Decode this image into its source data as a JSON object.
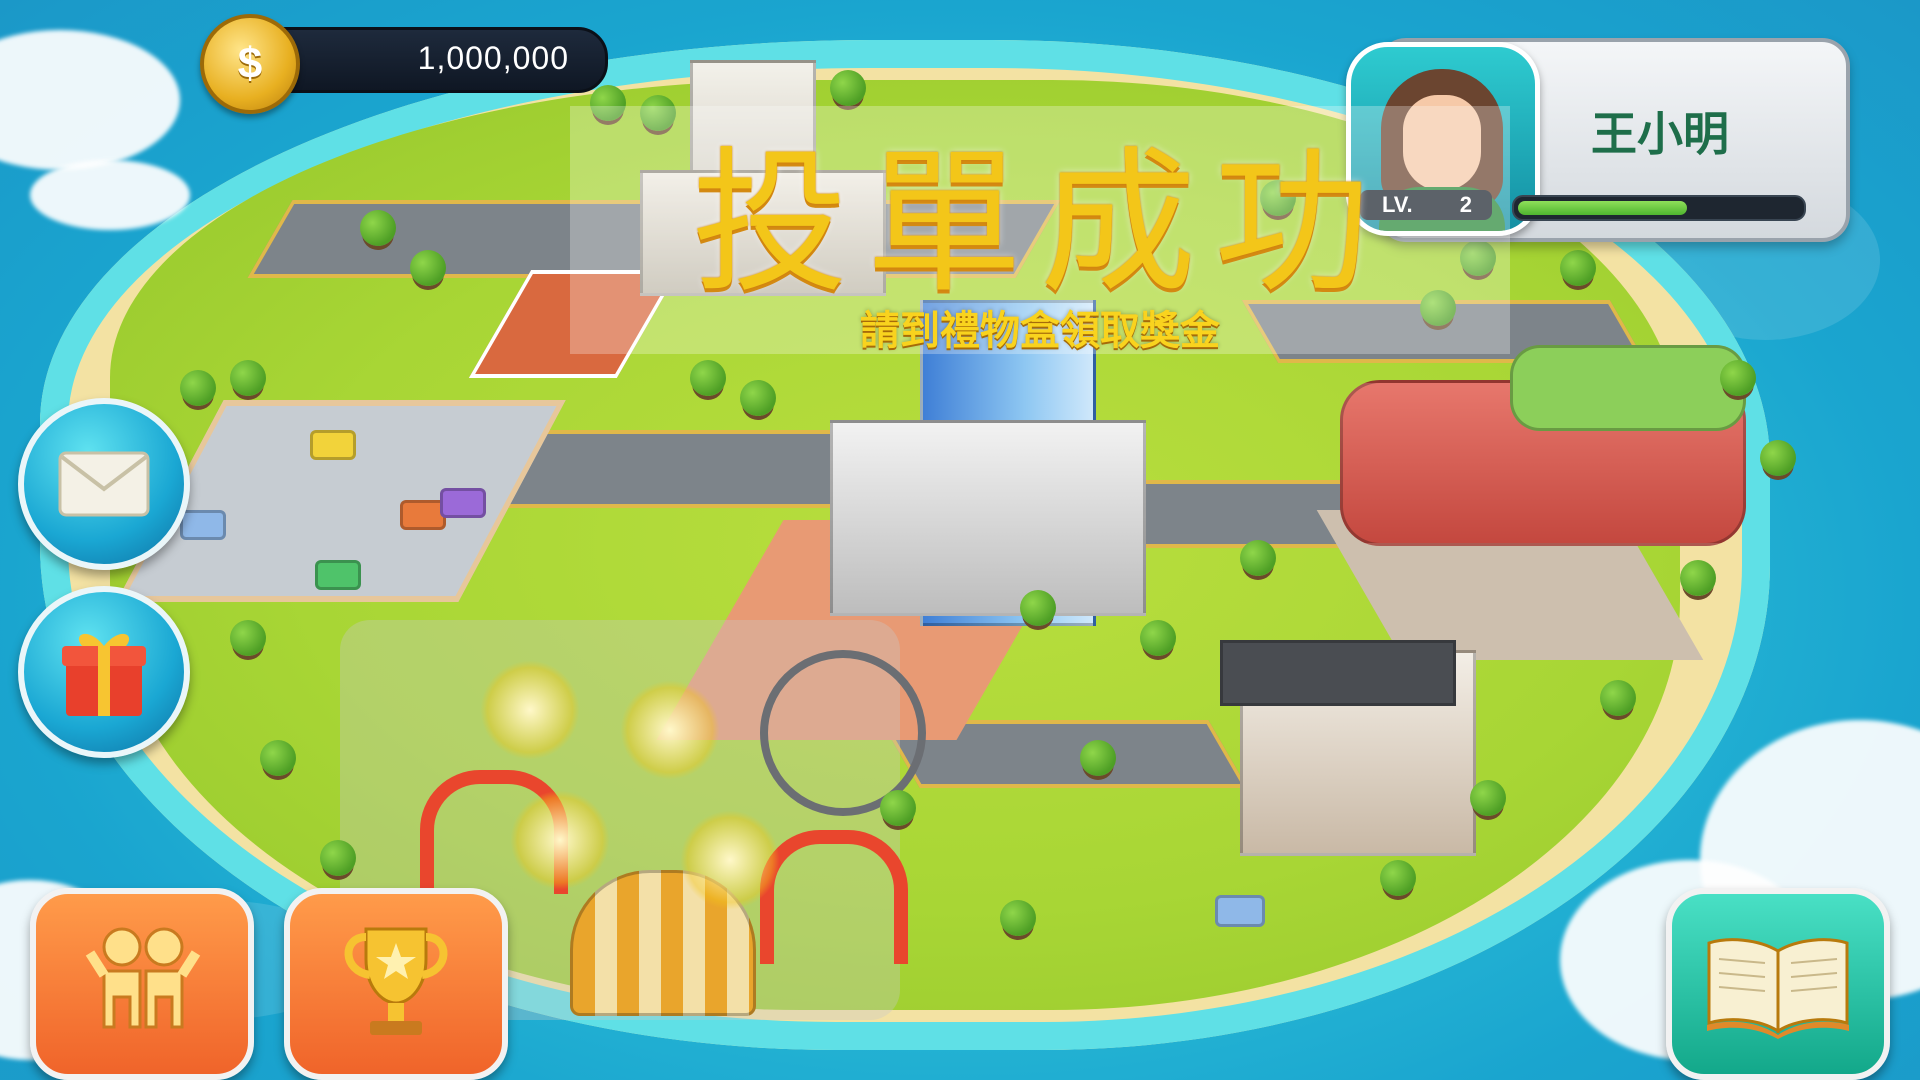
{
  "hud": {
    "coins": "1,000,000",
    "player": {
      "name": "王小明",
      "level_label": "LV.",
      "level_value": "2",
      "xp_fraction": 0.6
    }
  },
  "banner": {
    "title": "投單成功",
    "subtitle": "請到禮物盒領取獎金"
  },
  "icons": {
    "coin": "dollar-coin-icon",
    "mail": "envelope-icon",
    "gift": "gift-box-icon",
    "friends": "friends-icon",
    "trophy": "trophy-icon",
    "book": "open-book-icon",
    "avatar": "player-avatar"
  },
  "colors": {
    "sea": "#27b8d5",
    "grass": "#a8d635",
    "banner_text": "#f3c619",
    "name_text": "#1e6e4a",
    "xp_fill": "#4fb42f"
  }
}
